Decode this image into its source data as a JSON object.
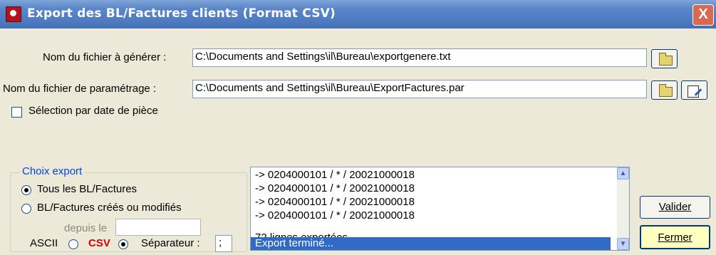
{
  "window": {
    "title": "Export des BL/Factures clients (Format CSV)",
    "close_label": "X"
  },
  "fichier_genere": {
    "label": "Nom du fichier à générer :",
    "value": "C:\\Documents and Settings\\il\\Bureau\\exportgenere.txt"
  },
  "fichier_param": {
    "label": "Nom du fichier de paramétrage :",
    "value": "C:\\Documents and Settings\\il\\Bureau\\ExportFactures.par"
  },
  "selection_date": {
    "label": "Sélection par date de pièce",
    "checked": false
  },
  "choix_export": {
    "title": "Choix export",
    "option_tous": "Tous les BL/Factures",
    "option_modifies": "BL/Factures créés ou modifiés",
    "depuis_label": "depuis le",
    "depuis_value": "",
    "ascii_label": "ASCII",
    "csv_label": "CSV",
    "separateur_label": "Séparateur :",
    "separateur_value": ";",
    "csv_color": "#d40000"
  },
  "log": {
    "lines": [
      "-> 0204000101 / * / 20021000018",
      "-> 0204000101 / * / 20021000018",
      "-> 0204000101 / * / 20021000018",
      "-> 0204000101 / * / 20021000018"
    ],
    "summary": "72 lignes exportées...",
    "status": "Export terminé..."
  },
  "buttons": {
    "valider": "Valider",
    "fermer": "Fermer"
  }
}
